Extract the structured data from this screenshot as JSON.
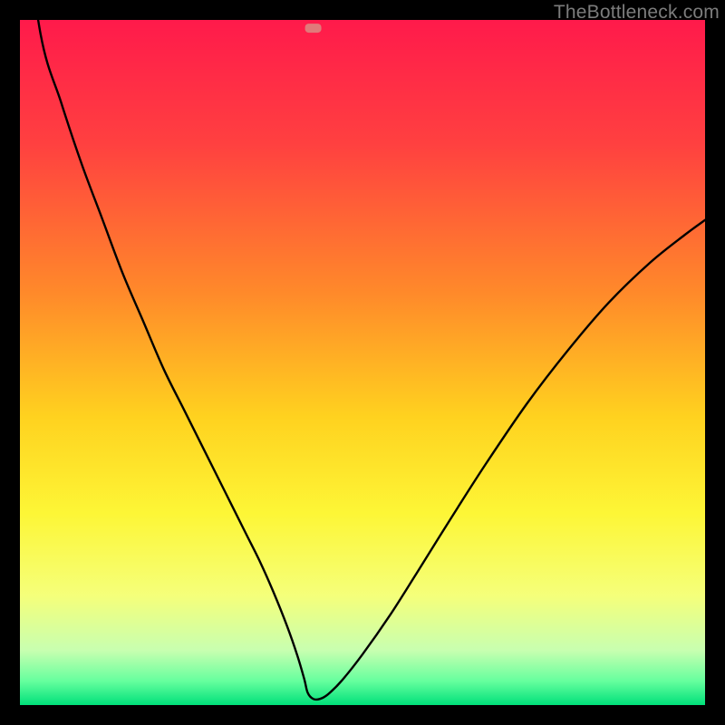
{
  "watermark": "TheBottleneck.com",
  "chart_data": {
    "type": "line",
    "title": "",
    "xlabel": "",
    "ylabel": "",
    "xlim": [
      0,
      100
    ],
    "ylim": [
      0,
      100
    ],
    "gradient_stops": [
      {
        "offset": 0,
        "color": "#ff1a4b"
      },
      {
        "offset": 0.18,
        "color": "#ff4040"
      },
      {
        "offset": 0.4,
        "color": "#ff8a2a"
      },
      {
        "offset": 0.58,
        "color": "#ffd21f"
      },
      {
        "offset": 0.72,
        "color": "#fdf636"
      },
      {
        "offset": 0.84,
        "color": "#f5ff7a"
      },
      {
        "offset": 0.92,
        "color": "#c8ffb0"
      },
      {
        "offset": 0.965,
        "color": "#66ff9e"
      },
      {
        "offset": 1.0,
        "color": "#00e07a"
      }
    ],
    "minimum_x": 42,
    "marker": {
      "x": 42.8,
      "y": 98.8,
      "color": "#e07a7a"
    },
    "series": [
      {
        "name": "bottleneck-curve",
        "x": [
          0,
          3,
          6,
          9,
          12,
          15,
          18,
          21,
          24,
          27,
          30,
          33,
          35,
          37,
          39,
          40.5,
          41.5,
          42.0,
          42.8,
          43.8,
          45,
          47,
          50,
          54,
          58,
          63,
          68,
          74,
          80,
          86,
          92,
          97,
          100
        ],
        "y": [
          120,
          98,
          88,
          79,
          71,
          63,
          56,
          49,
          43,
          37,
          31,
          25,
          21,
          16.5,
          11.5,
          7.2,
          3.8,
          1.8,
          0.9,
          0.9,
          1.6,
          3.6,
          7.4,
          13.1,
          19.4,
          27.4,
          35.2,
          44.0,
          51.8,
          58.8,
          64.6,
          68.6,
          70.8
        ]
      }
    ]
  }
}
